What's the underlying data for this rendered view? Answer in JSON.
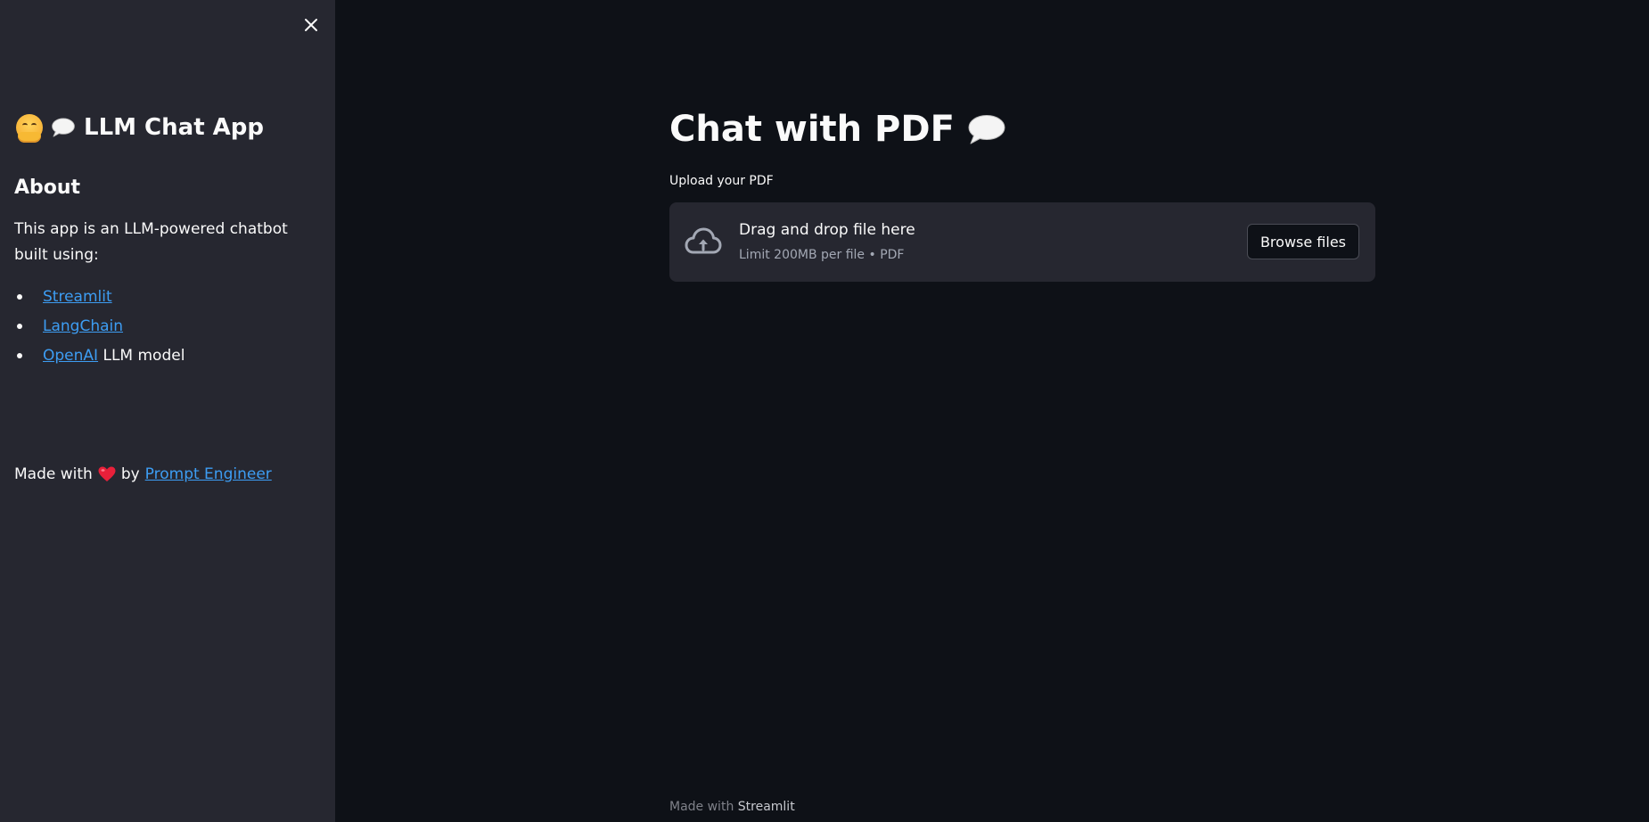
{
  "sidebar": {
    "title": "LLM Chat App",
    "about_heading": "About",
    "about_text": "This app is an LLM-powered chatbot built using:",
    "items": [
      {
        "link": "Streamlit",
        "suffix": ""
      },
      {
        "link": "LangChain",
        "suffix": ""
      },
      {
        "link": "OpenAI",
        "suffix": " LLM model"
      }
    ],
    "made_with_prefix": "Made with",
    "made_with_by": "by",
    "made_with_link": "Prompt Engineer"
  },
  "main": {
    "title": "Chat with PDF",
    "upload_label": "Upload your PDF",
    "dropzone": {
      "title": "Drag and drop file here",
      "limit": "Limit 200MB per file • PDF",
      "browse_label": "Browse files"
    },
    "footer_prefix": "Made with",
    "footer_brand": "Streamlit"
  },
  "colors": {
    "background": "#0e1117",
    "sidebar": "#262730",
    "link": "#3d9df3"
  },
  "icons": {
    "close": "close-icon",
    "upload": "cloud-upload-icon",
    "speech": "speech-bubble-icon",
    "hug": "hugging-face-icon",
    "heart": "heart-icon"
  }
}
